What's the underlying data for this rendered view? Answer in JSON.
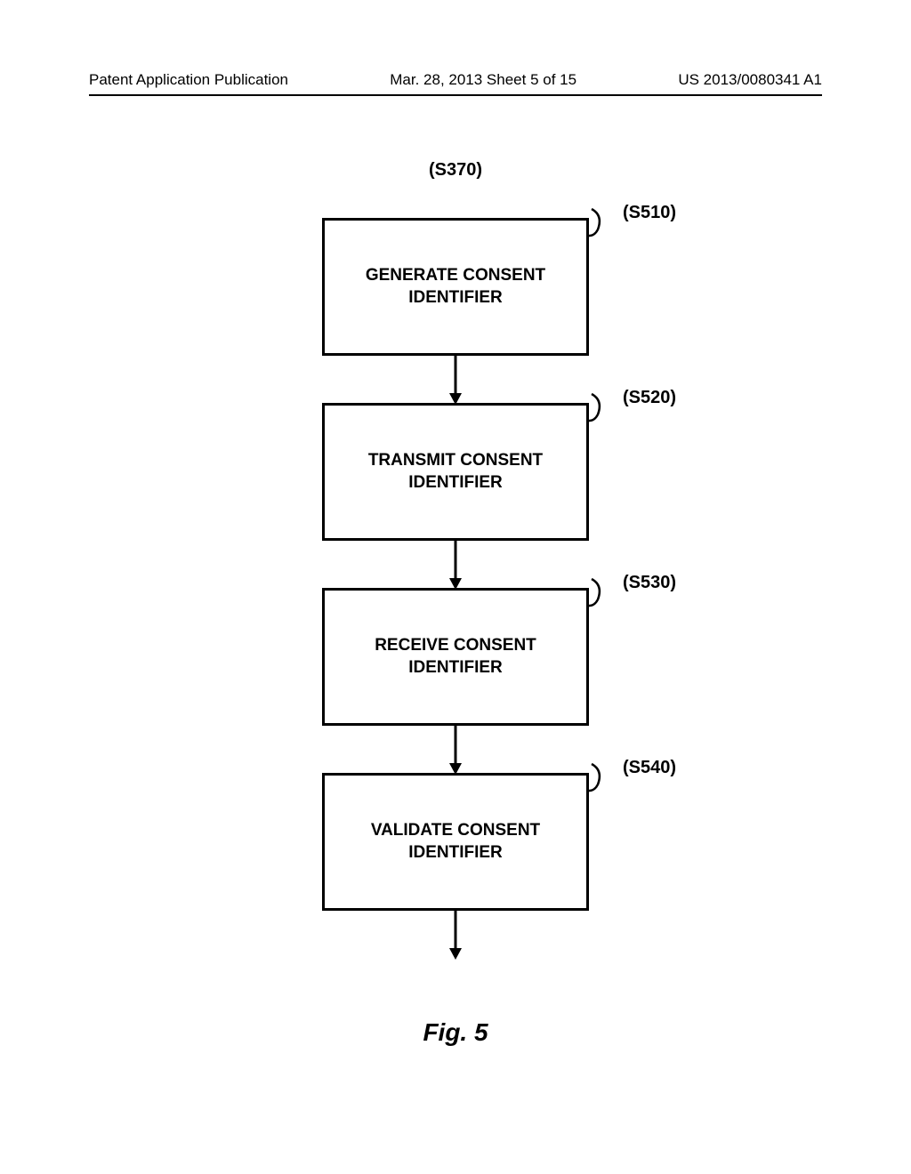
{
  "header": {
    "left": "Patent Application Publication",
    "center": "Mar. 28, 2013  Sheet 5 of 15",
    "right": "US 2013/0080341 A1"
  },
  "diagram": {
    "top_ref": "(S370)",
    "steps": [
      {
        "label": "GENERATE CONSENT\nIDENTIFIER",
        "ref": "(S510)"
      },
      {
        "label": "TRANSMIT CONSENT\nIDENTIFIER",
        "ref": "(S520)"
      },
      {
        "label": "RECEIVE CONSENT\nIDENTIFIER",
        "ref": "(S530)"
      },
      {
        "label": "VALIDATE CONSENT\nIDENTIFIER",
        "ref": "(S540)"
      }
    ],
    "figure_caption": "Fig. 5"
  }
}
